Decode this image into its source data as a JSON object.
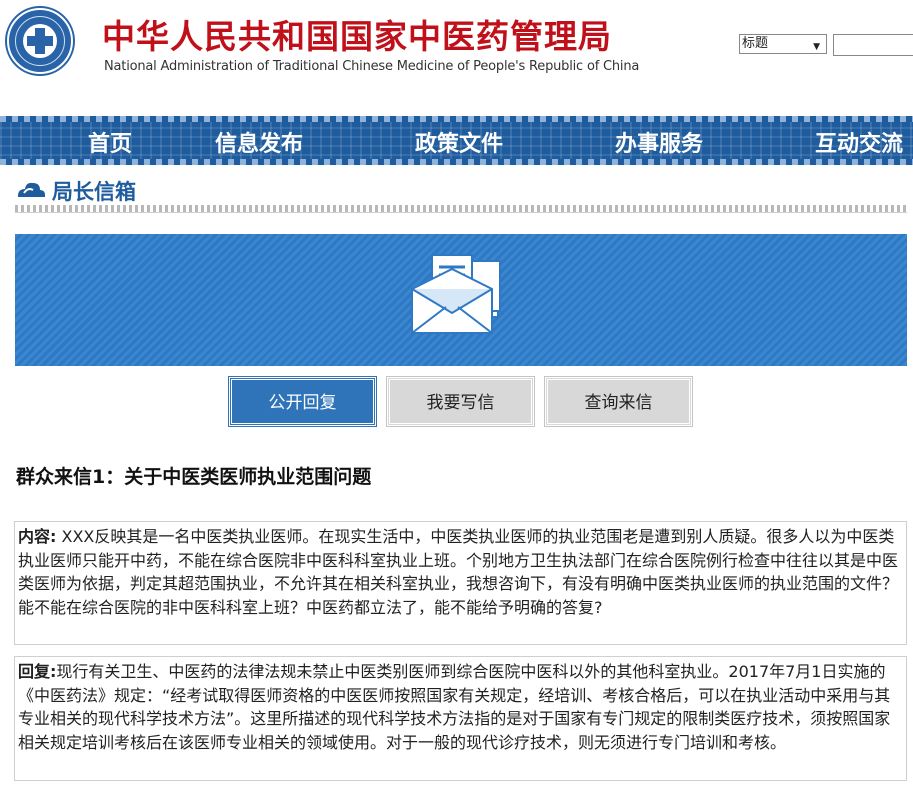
{
  "header": {
    "title": "中华人民共和国国家中医药管理局",
    "subtitle": "National Administration of Traditional Chinese Medicine of People's Republic of China"
  },
  "search": {
    "select_value": "标题",
    "input_value": ""
  },
  "nav": {
    "items": [
      "首页",
      "信息发布",
      "政策文件",
      "办事服务",
      "互动交流"
    ]
  },
  "section": {
    "title": "局长信箱"
  },
  "tabs": {
    "public_reply": "公开回复",
    "write_letter": "我要写信",
    "query_letter": "查询来信"
  },
  "letter": {
    "title": "群众来信1：关于中医类医师执业范围问题",
    "content_label": "内容:",
    "content_text": " XXX反映其是一名中医类执业医师。在现实生活中，中医类执业医师的执业范围老是遭到别人质疑。很多人以为中医类执业医师只能开中药，不能在综合医院非中医科科室执业上班。个别地方卫生执法部门在综合医院例行检查中往往以其是中医类医师为依据，判定其超范围执业，不允许其在相关科室执业，我想咨询下，有没有明确中医类执业医师的执业范围的文件？能不能在综合医院的非中医科科室上班？中医药都立法了，能不能给予明确的答复?",
    "reply_label": "回复:",
    "reply_text": "现行有关卫生、中医药的法律法规未禁止中医类别医师到综合医院中医科以外的其他科室执业。2017年7月1日实施的《中医药法》规定：“经考试取得医师资格的中医医师按照国家有关规定，经培训、考核合格后，可以在执业活动中采用与其专业相关的现代科学技术方法”。这里所描述的现代科学技术方法指的是对于国家有专门规定的限制类医疗技术，须按照国家相关规定培训考核后在该医师专业相关的领域使用。对于一般的现代诊疗技术，则无须进行专门培训和考核。"
  },
  "colors": {
    "title_red": "#c0111a",
    "nav_blue": "#1f5c9e",
    "banner_blue": "#3a86cf",
    "active_tab": "#2f73b8"
  }
}
